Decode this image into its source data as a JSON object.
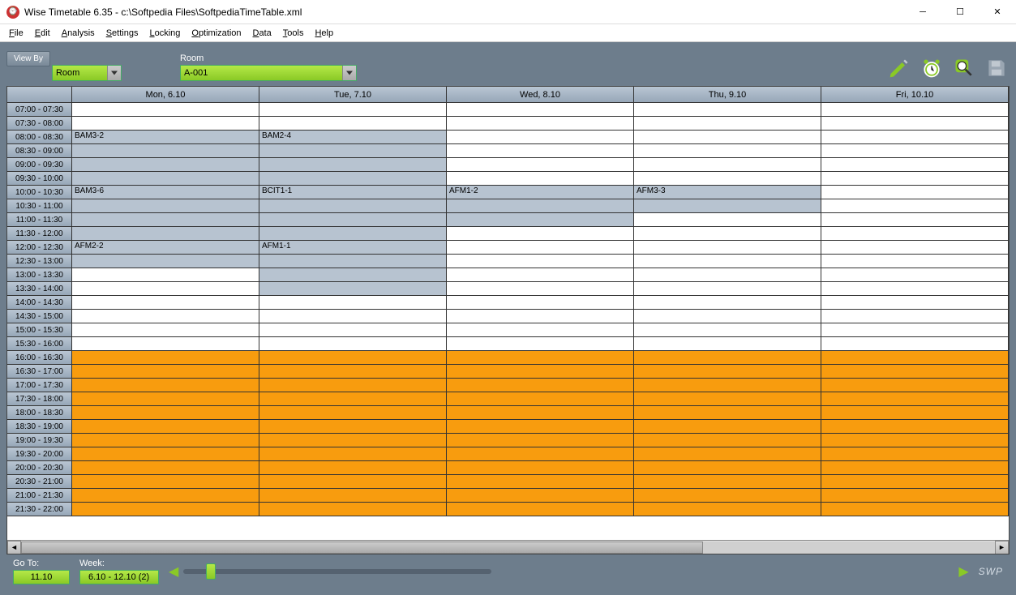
{
  "title": "Wise Timetable 6.35 - c:\\Softpedia Files\\SoftpediaTimeTable.xml",
  "menu": [
    "File",
    "Edit",
    "Analysis",
    "Settings",
    "Locking",
    "Optimization",
    "Data",
    "Tools",
    "Help"
  ],
  "viewby_btn": "View By",
  "viewby_label": "",
  "viewby_value": "Room",
  "room_label": "Room",
  "room_value": "A-001",
  "days": [
    "Mon, 6.10",
    "Tue, 7.10",
    "Wed, 8.10",
    "Thu, 9.10",
    "Fri, 10.10"
  ],
  "timeslots": [
    "07:00 - 07:30",
    "07:30 - 08:00",
    "08:00 - 08:30",
    "08:30 - 09:00",
    "09:00 - 09:30",
    "09:30 - 10:00",
    "10:00 - 10:30",
    "10:30 - 11:00",
    "11:00 - 11:30",
    "11:30 - 12:00",
    "12:00 - 12:30",
    "12:30 - 13:00",
    "13:00 - 13:30",
    "13:30 - 14:00",
    "14:00 - 14:30",
    "14:30 - 15:00",
    "15:00 - 15:30",
    "15:30 - 16:00",
    "16:00 - 16:30",
    "16:30 - 17:00",
    "17:00 - 17:30",
    "17:30 - 18:00",
    "18:00 - 18:30",
    "18:30 - 19:00",
    "19:00 - 19:30",
    "19:30 - 20:00",
    "20:00 - 20:30",
    "20:30 - 21:00",
    "21:00 - 21:30",
    "21:30 - 22:00"
  ],
  "events": [
    {
      "day": 0,
      "start": 2,
      "end": 5,
      "label": "BAM3-2"
    },
    {
      "day": 1,
      "start": 2,
      "end": 5,
      "label": "BAM2-4"
    },
    {
      "day": 0,
      "start": 6,
      "end": 9,
      "label": "BAM3-6"
    },
    {
      "day": 1,
      "start": 6,
      "end": 9,
      "label": "BCIT1-1"
    },
    {
      "day": 2,
      "start": 6,
      "end": 8,
      "label": "AFM1-2"
    },
    {
      "day": 3,
      "start": 6,
      "end": 7,
      "label": "AFM3-3"
    },
    {
      "day": 0,
      "start": 10,
      "end": 11,
      "label": "AFM2-2"
    },
    {
      "day": 1,
      "start": 10,
      "end": 13,
      "label": "AFM1-1"
    }
  ],
  "blocked_from": 18,
  "goto_label": "Go To:",
  "goto_value": "11.10",
  "week_label": "Week:",
  "week_value": "6.10 - 12.10  (2)",
  "swp": "SWP"
}
